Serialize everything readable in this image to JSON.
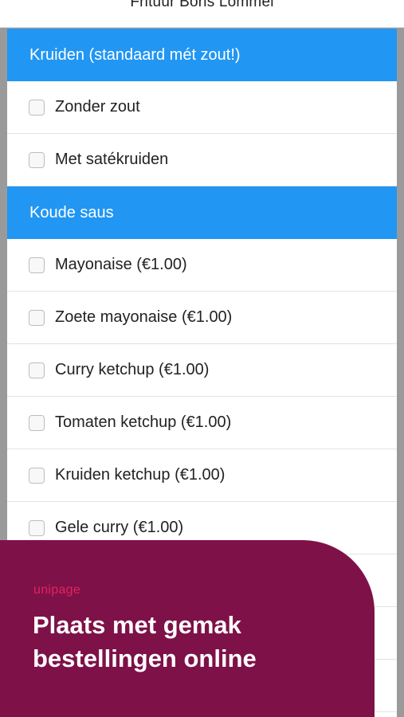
{
  "header": {
    "title": "Frituur Boris Lommel"
  },
  "sections": [
    {
      "title": "Kruiden (standaard mét zout!)",
      "options": [
        {
          "label": "Zonder zout",
          "checked": false
        },
        {
          "label": "Met satékruiden",
          "checked": false
        }
      ]
    },
    {
      "title": "Koude saus",
      "options": [
        {
          "label": "Mayonaise (€1.00)",
          "checked": false
        },
        {
          "label": "Zoete mayonaise (€1.00)",
          "checked": false
        },
        {
          "label": "Curry ketchup (€1.00)",
          "checked": false
        },
        {
          "label": "Tomaten ketchup (€1.00)",
          "checked": false
        },
        {
          "label": "Kruiden ketchup (€1.00)",
          "checked": false
        },
        {
          "label": "Gele curry (€1.00)",
          "checked": false
        }
      ]
    }
  ],
  "banner": {
    "logo": "unipage",
    "line1": "Plaats met gemak",
    "line2": "bestellingen online"
  },
  "colors": {
    "section_header_bg": "#2196f3",
    "banner_bg": "#7e1148",
    "logo": "#e0245e"
  }
}
